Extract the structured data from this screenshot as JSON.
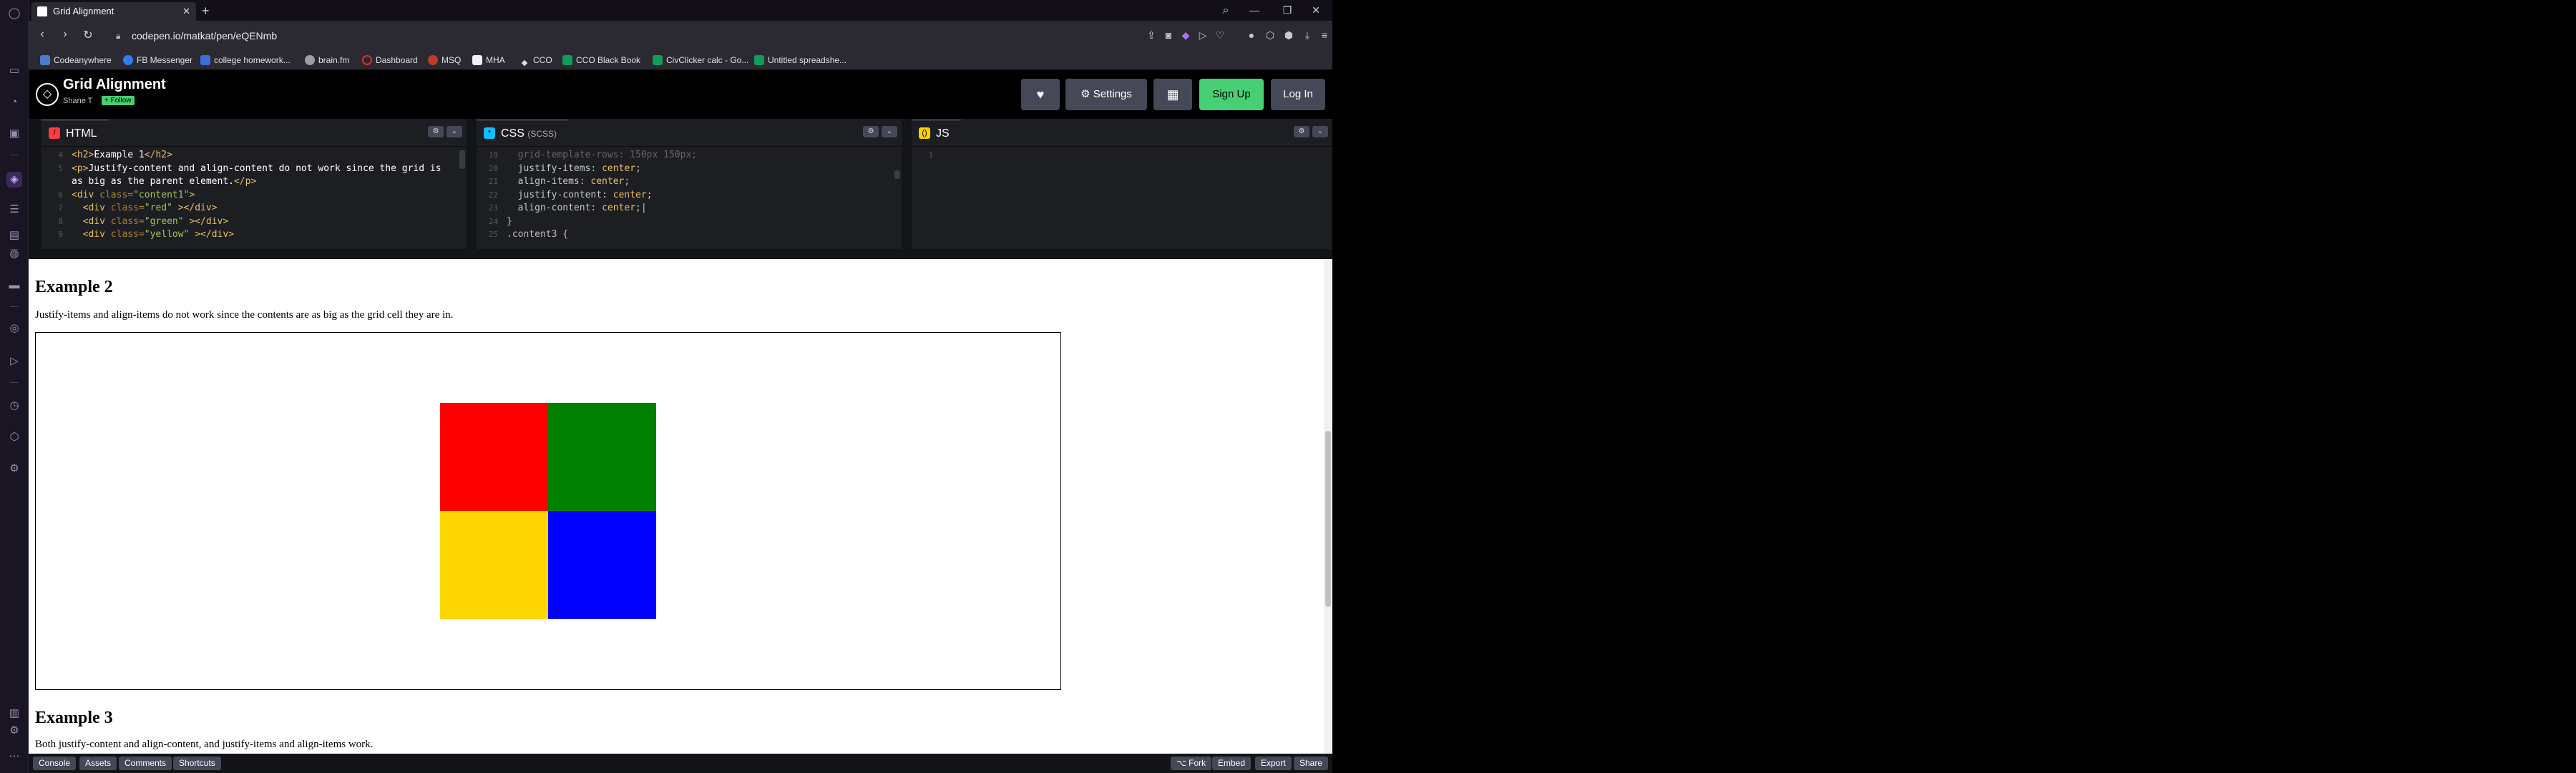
{
  "browser": {
    "tab_title": "Grid Alignment",
    "tab_close": "✕",
    "new_tab": "+",
    "url": "codepen.io/matkat/pen/eQENmb",
    "window_controls": [
      "—",
      "❐",
      "✕"
    ],
    "bookmarks": [
      {
        "label": "Codeanywhere",
        "color": "#4a7bd0"
      },
      {
        "label": "FB Messenger",
        "color": "#2f80ed"
      },
      {
        "label": "college homework...",
        "color": "#3b6fd8"
      },
      {
        "label": "brain.fm",
        "color": "#9aa0a6"
      },
      {
        "label": "Dashboard",
        "color": "#d93025"
      },
      {
        "label": "MSQ",
        "color": "#c0392b"
      },
      {
        "label": "MHA",
        "color": "#f0f0f0"
      },
      {
        "label": "CCO",
        "color": "#dddddd"
      },
      {
        "label": "CCO Black Book",
        "color": "#0f9d58"
      },
      {
        "label": "CivClicker calc - Go...",
        "color": "#0f9d58"
      },
      {
        "label": "Untitled spreadshe...",
        "color": "#0f9d58"
      }
    ]
  },
  "codepen": {
    "title": "Grid Alignment",
    "user": "Shane T",
    "follow": "+ Follow",
    "settings_label": "Settings",
    "signup_label": "Sign Up",
    "login_label": "Log In",
    "heart": "♥",
    "colors": {
      "green": "#47cf73",
      "button": "#444857"
    }
  },
  "editors": {
    "html": {
      "label": "HTML",
      "lines": [
        {
          "n": "4",
          "tokens": [
            [
              "t-tag",
              "<h2>"
            ],
            [
              "t-txt",
              "Example 1"
            ],
            [
              "t-tag",
              "</h2>"
            ]
          ]
        },
        {
          "n": "5",
          "tokens": [
            [
              "t-tag",
              "<p>"
            ],
            [
              "t-txt",
              "Justify-content and align-content do not work since the grid is"
            ]
          ]
        },
        {
          "n": "",
          "tokens": [
            [
              "t-txt",
              "as big as the parent element."
            ],
            [
              "t-tag",
              "</p>"
            ]
          ]
        },
        {
          "n": "6",
          "tokens": [
            [
              "t-tag",
              "<div "
            ],
            [
              "t-attr",
              "class="
            ],
            [
              "t-str",
              "\"content1\""
            ],
            [
              "t-tag",
              ">"
            ]
          ]
        },
        {
          "n": "7",
          "tokens": [
            [
              "t-tag",
              "  <div "
            ],
            [
              "t-attr",
              "class="
            ],
            [
              "t-str",
              "\"red\""
            ],
            [
              "t-tag",
              " ></div>"
            ]
          ]
        },
        {
          "n": "8",
          "tokens": [
            [
              "t-tag",
              "  <div "
            ],
            [
              "t-attr",
              "class="
            ],
            [
              "t-str",
              "\"green\""
            ],
            [
              "t-tag",
              " ></div>"
            ]
          ]
        },
        {
          "n": "9",
          "tokens": [
            [
              "t-tag",
              "  <div "
            ],
            [
              "t-attr",
              "class="
            ],
            [
              "t-str",
              "\"yellow\""
            ],
            [
              "t-tag",
              " ></div>"
            ]
          ]
        }
      ]
    },
    "css": {
      "label": "CSS",
      "sublabel": "(SCSS)",
      "lines": [
        {
          "n": "19",
          "tokens": [
            [
              "t-dim",
              "  grid-template-rows: 150px 150px;"
            ]
          ]
        },
        {
          "n": "20",
          "tokens": [
            [
              "t-prop",
              "  justify-items: "
            ],
            [
              "t-val",
              "center"
            ],
            [
              "t-prop",
              ";"
            ]
          ]
        },
        {
          "n": "21",
          "tokens": [
            [
              "t-prop",
              "  align-items: "
            ],
            [
              "t-val",
              "center"
            ],
            [
              "t-prop",
              ";"
            ]
          ]
        },
        {
          "n": "22",
          "tokens": [
            [
              "t-prop",
              "  justify-content: "
            ],
            [
              "t-val",
              "center"
            ],
            [
              "t-prop",
              ";"
            ]
          ]
        },
        {
          "n": "23",
          "tokens": [
            [
              "t-prop",
              "  align-content: "
            ],
            [
              "t-val",
              "center"
            ],
            [
              "t-prop",
              ";|"
            ]
          ]
        },
        {
          "n": "24",
          "tokens": [
            [
              "t-sel",
              "}"
            ]
          ]
        },
        {
          "n": "25",
          "tokens": [
            [
              "t-sel",
              ".content3 {"
            ]
          ]
        }
      ]
    },
    "js": {
      "label": "JS",
      "lines": [
        {
          "n": "1",
          "tokens": [
            [
              "t-dim",
              ""
            ]
          ]
        }
      ]
    }
  },
  "preview": {
    "example2_title": "Example 2",
    "example2_text": "Justify-items and align-items do not work since the contents are as big as the grid cell they are in.",
    "example3_title": "Example 3",
    "example3_text": "Both justify-content and align-content, and justify-items and align-items work.",
    "cells": [
      {
        "name": "red",
        "color": "#ff0000"
      },
      {
        "name": "green",
        "color": "#008000"
      },
      {
        "name": "yellow",
        "color": "#ffd700"
      },
      {
        "name": "blue",
        "color": "#0000ff"
      }
    ]
  },
  "bottombar": {
    "left": [
      "Console",
      "Assets",
      "Comments",
      "Shortcuts"
    ],
    "right": [
      "⌥ Fork",
      "Embed",
      "Export",
      "Share"
    ]
  }
}
